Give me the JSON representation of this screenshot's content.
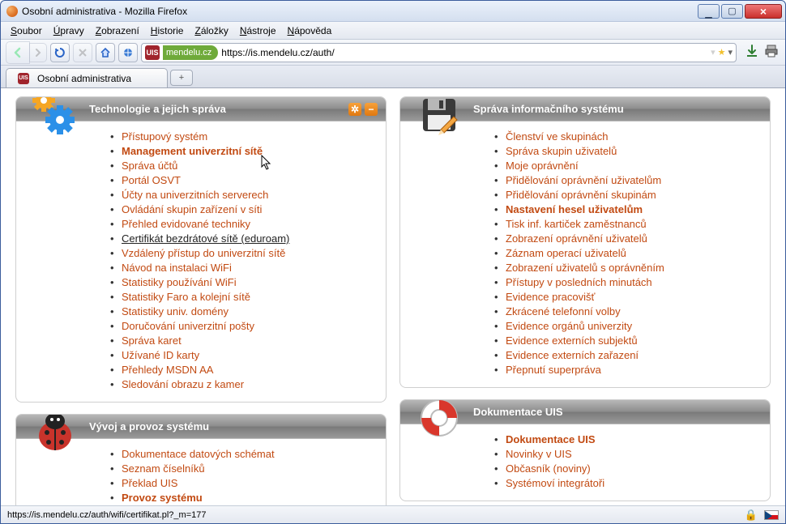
{
  "window": {
    "title": "Osobní administrativa - Mozilla Firefox"
  },
  "menu": [
    "Soubor",
    "Úpravy",
    "Zobrazení",
    "Historie",
    "Záložky",
    "Nástroje",
    "Nápověda"
  ],
  "nav": {
    "badge_domain": "mendelu.cz",
    "url": "https://is.mendelu.cz/auth/",
    "favicon_text": "UIS"
  },
  "tab": {
    "title": "Osobní administrativa"
  },
  "status": {
    "text": "https://is.mendelu.cz/auth/wifi/certifikat.pl?_m=177"
  },
  "panels": {
    "tech": {
      "title": "Technologie a jejich správa",
      "items": [
        {
          "label": "Přístupový systém"
        },
        {
          "label": "Management univerzitní sítě",
          "bold": true
        },
        {
          "label": "Správa účtů"
        },
        {
          "label": "Portál OSVT"
        },
        {
          "label": "Účty na univerzitních serverech"
        },
        {
          "label": "Ovládání skupin zařízení v síti"
        },
        {
          "label": "Přehled evidované techniky"
        },
        {
          "label": "Certifikát bezdrátové sítě (eduroam)",
          "hovered": true
        },
        {
          "label": "Vzdálený přístup do univerzitní sítě"
        },
        {
          "label": "Návod na instalaci WiFi"
        },
        {
          "label": "Statistiky používání WiFi"
        },
        {
          "label": "Statistiky Faro a kolejní sítě"
        },
        {
          "label": "Statistiky univ. domény"
        },
        {
          "label": "Doručování univerzitní pošty"
        },
        {
          "label": "Správa karet"
        },
        {
          "label": "Užívané ID karty"
        },
        {
          "label": "Přehledy MSDN AA"
        },
        {
          "label": "Sledování obrazu z kamer"
        }
      ]
    },
    "admin": {
      "title": "Správa informačního systému",
      "items": [
        {
          "label": "Členství ve skupinách"
        },
        {
          "label": "Správa skupin uživatelů"
        },
        {
          "label": "Moje oprávnění"
        },
        {
          "label": "Přidělování oprávnění uživatelům"
        },
        {
          "label": "Přidělování oprávnění skupinám"
        },
        {
          "label": "Nastavení hesel uživatelům",
          "bold": true
        },
        {
          "label": "Tisk inf. kartiček zaměstnanců"
        },
        {
          "label": "Zobrazení oprávnění uživatelů"
        },
        {
          "label": "Záznam operací uživatelů"
        },
        {
          "label": "Zobrazení uživatelů s oprávněním"
        },
        {
          "label": "Přístupy v posledních minutách"
        },
        {
          "label": "Evidence pracovišť"
        },
        {
          "label": "Zkrácené telefonní volby"
        },
        {
          "label": "Evidence orgánů univerzity"
        },
        {
          "label": "Evidence externích subjektů"
        },
        {
          "label": "Evidence externích zařazení"
        },
        {
          "label": "Přepnutí superpráva"
        }
      ]
    },
    "dev": {
      "title": "Vývoj a provoz systému",
      "items": [
        {
          "label": "Dokumentace datových schémat"
        },
        {
          "label": "Seznam číselníků"
        },
        {
          "label": "Překlad UIS"
        },
        {
          "label": "Provoz systému",
          "bold": true
        }
      ]
    },
    "docs": {
      "title": "Dokumentace UIS",
      "items": [
        {
          "label": "Dokumentace UIS",
          "bold": true
        },
        {
          "label": "Novinky v UIS"
        },
        {
          "label": "Občasník (noviny)"
        },
        {
          "label": "Systémoví integrátoři"
        }
      ]
    }
  }
}
